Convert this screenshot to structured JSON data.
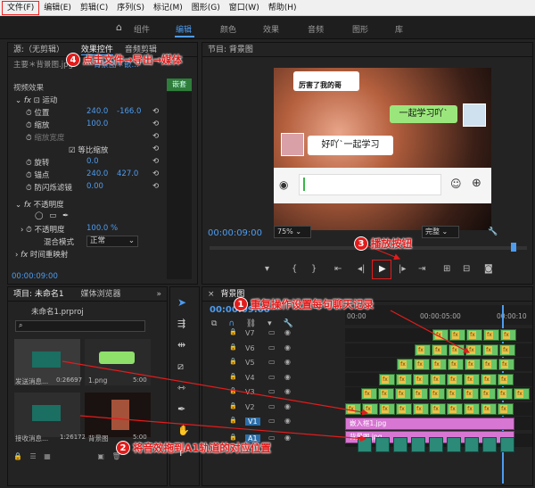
{
  "menu": [
    "文件(F)",
    "编辑(E)",
    "剪辑(C)",
    "序列(S)",
    "标记(M)",
    "图形(G)",
    "窗口(W)",
    "帮助(H)"
  ],
  "workspaces": [
    "组件",
    "编辑",
    "颜色",
    "效果",
    "音频",
    "图形",
    "库"
  ],
  "source_panel": {
    "title": "源:（无剪辑）",
    "tabs": [
      "效果控件",
      "音频剪辑"
    ],
    "clip_source": "主要＊背景图.jpg",
    "clip_seq": "背景图＊嵌...",
    "tag": "嵌套",
    "section": "视频效果",
    "fx_motion": "运动",
    "properties": [
      {
        "name": "位置",
        "v1": "240.0",
        "v2": "-166.0"
      },
      {
        "name": "缩放",
        "v1": "100.0",
        "v2": ""
      },
      {
        "name": "缩放宽度",
        "v1": "",
        "v2": ""
      },
      {
        "name": "等比缩放",
        "v1": "",
        "v2": ""
      },
      {
        "name": "旋转",
        "v1": "0.0",
        "v2": ""
      },
      {
        "name": "锚点",
        "v1": "240.0",
        "v2": "427.0"
      },
      {
        "name": "防闪烁滤镜",
        "v1": "0.00",
        "v2": ""
      }
    ],
    "opacity_fx": "不透明度",
    "opacity": "100.0 %",
    "blend_label": "混合模式",
    "blend_value": "正常",
    "time_remap": "时间重映射",
    "timecode": "00:00:09:00"
  },
  "program": {
    "title": "节目: 背景图",
    "timecode": "00:00:09:00",
    "fit": "75%",
    "quality": "完整",
    "video": {
      "caption": "厉害了我的哥",
      "chat_right": "一起学习吖`",
      "chat_left": "好吖`一起学习"
    }
  },
  "project": {
    "tabs": [
      "项目: 未命名1",
      "媒体浏览器"
    ],
    "file": "未命名1.prproj",
    "items": [
      {
        "name": "发送消息...",
        "dur": "0:26697"
      },
      {
        "name": "1.png",
        "dur": "5:00"
      },
      {
        "name": "接收消息...",
        "dur": "1:26172"
      },
      {
        "name": "背景图",
        "dur": "5:00"
      }
    ]
  },
  "timeline": {
    "title": "背景图",
    "timecode": "00:00:09:00",
    "ruler": [
      "00:00",
      "00:00:05:00",
      "00:00:10"
    ],
    "tracks": [
      "V7",
      "V6",
      "V5",
      "V4",
      "V3",
      "V2",
      "V1",
      "A1"
    ],
    "clip_nested": "嵌入框1.jpg",
    "clip_bg": "背景图.jpg"
  },
  "annotations": [
    {
      "num": "4",
      "text": "点击文件→导出→媒体"
    },
    {
      "num": "3",
      "text": "播放按钮"
    },
    {
      "num": "1",
      "text": "重复操作设置每句聊天记录"
    },
    {
      "num": "2",
      "text": "将音效拖到A1轨道的对应位置"
    }
  ],
  "colors": {
    "accent": "#4d9cf0",
    "annotation": "#e21c1c",
    "video_clip": "#67c567",
    "audio_clip": "#2b8a78",
    "nested_clip": "#d776d3"
  }
}
